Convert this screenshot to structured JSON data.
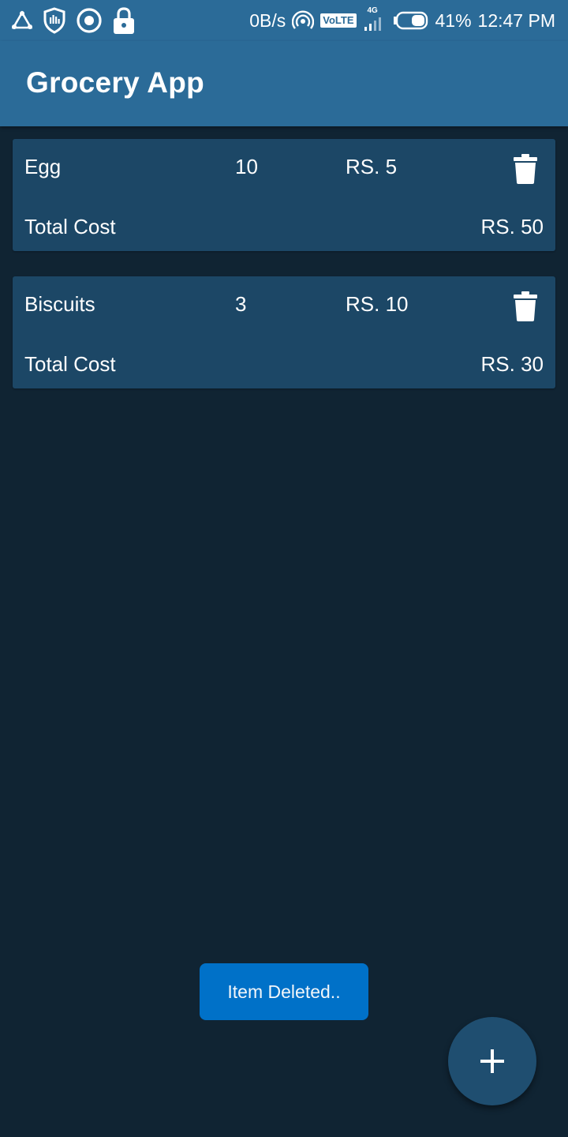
{
  "status_bar": {
    "net_speed": "0B/s",
    "volte": "VoLTE",
    "network": "4G",
    "battery": "41%",
    "time": "12:47 PM"
  },
  "app_bar": {
    "title": "Grocery App"
  },
  "items": [
    {
      "name": "Egg",
      "qty": "10",
      "price": "RS. 5",
      "total_label": "Total Cost",
      "total": "RS. 50"
    },
    {
      "name": "Biscuits",
      "qty": "3",
      "price": "RS. 10",
      "total_label": "Total Cost",
      "total": "RS. 30"
    }
  ],
  "toast": {
    "message": "Item Deleted.."
  },
  "icons": {
    "delete": "trash-icon",
    "fab": "plus-icon"
  },
  "colors": {
    "app_bar": "#2b6b98",
    "background": "#102433",
    "card": "#1c4766",
    "toast": "#0071c8",
    "fab": "#1f4e70"
  }
}
